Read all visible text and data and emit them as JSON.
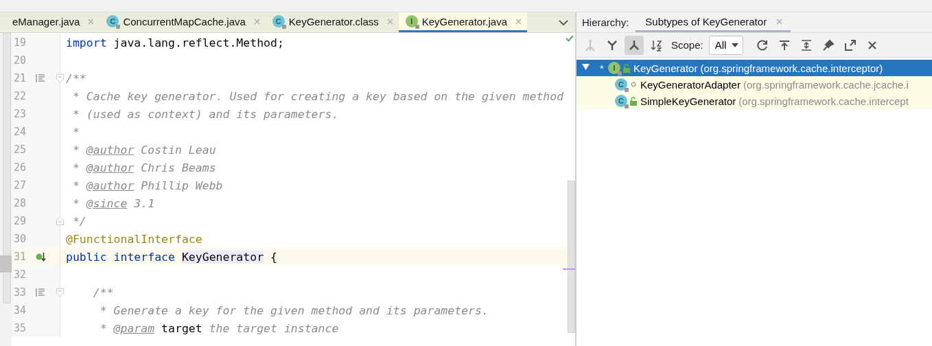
{
  "editor": {
    "tabs": [
      {
        "label": "eManager.java",
        "selected": false
      },
      {
        "label": "ConcurrentMapCache.java",
        "icon_letter": "C",
        "selected": false
      },
      {
        "label": "KeyGenerator.class",
        "icon_letter": "C",
        "selected": false
      },
      {
        "label": "KeyGenerator.java",
        "icon_letter": "I",
        "selected": true
      }
    ],
    "lines": [
      {
        "number": "19",
        "current": false,
        "tokens": [
          {
            "text": "import",
            "kind": "keyword"
          },
          {
            "text": " java.lang.reflect.Method;",
            "kind": "plain"
          }
        ]
      },
      {
        "number": "20",
        "current": false
      },
      {
        "number": "21",
        "current": false,
        "doc_toggle": true,
        "fold_start": true,
        "tokens": [
          {
            "text": "/**",
            "kind": "comment"
          }
        ]
      },
      {
        "number": "22",
        "current": false,
        "tokens": [
          {
            "text": " * Cache key generator. Used for creating a key based on the given method",
            "kind": "comment"
          }
        ]
      },
      {
        "number": "23",
        "current": false,
        "tokens": [
          {
            "text": " * (used as context) and its parameters.",
            "kind": "comment"
          }
        ]
      },
      {
        "number": "24",
        "current": false,
        "tokens": [
          {
            "text": " *",
            "kind": "comment"
          }
        ]
      },
      {
        "number": "25",
        "current": false,
        "tokens": [
          {
            "text": " * ",
            "kind": "comment"
          },
          {
            "text": "@author",
            "kind": "tag"
          },
          {
            "text": " Costin Leau",
            "kind": "comment"
          }
        ]
      },
      {
        "number": "26",
        "current": false,
        "tokens": [
          {
            "text": " * ",
            "kind": "comment"
          },
          {
            "text": "@author",
            "kind": "tag"
          },
          {
            "text": " Chris Beams",
            "kind": "comment"
          }
        ]
      },
      {
        "number": "27",
        "current": false,
        "tokens": [
          {
            "text": " * ",
            "kind": "comment"
          },
          {
            "text": "@author",
            "kind": "tag"
          },
          {
            "text": " Phillip Webb",
            "kind": "comment"
          }
        ]
      },
      {
        "number": "28",
        "current": false,
        "tokens": [
          {
            "text": " * ",
            "kind": "comment"
          },
          {
            "text": "@since",
            "kind": "tag"
          },
          {
            "text": " 3.1",
            "kind": "comment"
          }
        ]
      },
      {
        "number": "29",
        "current": false,
        "fold_end": true,
        "tokens": [
          {
            "text": " */",
            "kind": "comment"
          }
        ]
      },
      {
        "number": "30",
        "current": false,
        "tokens": [
          {
            "text": "@FunctionalInterface",
            "kind": "annotation"
          }
        ]
      },
      {
        "number": "31",
        "current": true,
        "implemented_marker": true,
        "tokens": [
          {
            "text": "public interface ",
            "kind": "keyword"
          },
          {
            "text": "KeyGenerator",
            "kind": "highlight"
          },
          {
            "text": " {",
            "kind": "plain"
          }
        ]
      },
      {
        "number": "32",
        "current": false
      },
      {
        "number": "33",
        "current": false,
        "doc_toggle": true,
        "fold_start": true,
        "tokens": [
          {
            "text": "    /**",
            "kind": "comment"
          }
        ]
      },
      {
        "number": "34",
        "current": false,
        "tokens": [
          {
            "text": "     * Generate a key for the given method and its parameters.",
            "kind": "comment"
          }
        ]
      },
      {
        "number": "35",
        "current": false,
        "tokens": [
          {
            "text": "     * ",
            "kind": "comment"
          },
          {
            "text": "@param",
            "kind": "tag"
          },
          {
            "text": " target",
            "kind": "param"
          },
          {
            "text": " the target instance",
            "kind": "comment"
          }
        ]
      }
    ]
  },
  "hierarchy": {
    "label": "Hierarchy:",
    "tab": {
      "label": "Subtypes of KeyGenerator",
      "selected": true
    },
    "toolbar": [
      {
        "kind": "supertypes",
        "selected": false,
        "disabled": true
      },
      {
        "kind": "class-hierarchy",
        "selected": false,
        "disabled": false
      },
      {
        "kind": "subtypes",
        "selected": true,
        "disabled": false
      },
      {
        "kind": "sort",
        "selected": false,
        "disabled": false
      }
    ],
    "scope": {
      "label": "Scope:",
      "value": "All"
    },
    "actions": [
      {
        "kind": "refresh"
      },
      {
        "kind": "export"
      },
      {
        "kind": "expand"
      },
      {
        "kind": "pin"
      },
      {
        "kind": "open"
      },
      {
        "kind": "close"
      }
    ],
    "tree": [
      {
        "marker": "*",
        "icon_letter": "I",
        "public": true,
        "name": "KeyGenerator",
        "package": "(org.springframework.cache.interceptor)",
        "selected": true,
        "expanded": true,
        "children": [
          {
            "icon_letter": "C",
            "public": false,
            "name": "KeyGeneratorAdapter",
            "package": "(org.springframework.cache.jcache.i",
            "selected": false
          },
          {
            "icon_letter": "C",
            "public": true,
            "name": "SimpleKeyGenerator",
            "package": "(org.springframework.cache.intercept",
            "selected": false
          }
        ]
      }
    ]
  }
}
